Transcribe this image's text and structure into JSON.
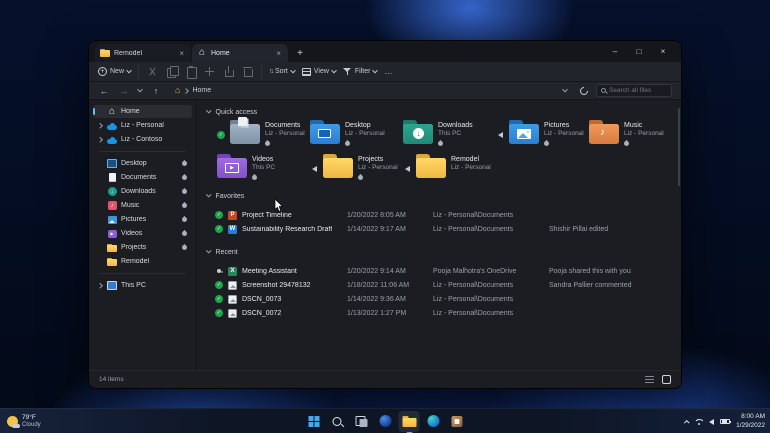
{
  "colors": {
    "accent": "#6cb8f0",
    "folder_yellow": "#f2b844",
    "status_green": "#1da54a"
  },
  "window": {
    "tabs": [
      {
        "label": "Remodel",
        "icon": "folder",
        "active": false,
        "close_icon": "×"
      },
      {
        "label": "Home",
        "icon": "home",
        "active": true,
        "close_icon": "×"
      }
    ],
    "new_tab_icon": "+",
    "controls": {
      "minimize": "–",
      "maximize": "□",
      "close": "×"
    },
    "toolbar": {
      "new_label": "New",
      "actions": [
        {
          "name": "cut-icon"
        },
        {
          "name": "copy-icon"
        },
        {
          "name": "paste-icon"
        },
        {
          "name": "rename-icon"
        },
        {
          "name": "share-icon"
        },
        {
          "name": "delete-icon"
        }
      ],
      "sort_label": "Sort",
      "view_label": "View",
      "filter_label": "Filter",
      "more_icon": "…"
    },
    "address": {
      "breadcrumb": "Home",
      "search_placeholder": "Search all files"
    },
    "sidebar": {
      "top_items": [
        {
          "label": "Home",
          "icon": "home",
          "selected": true
        },
        {
          "label": "Liz - Personal",
          "icon": "onedrive",
          "expandable": true
        },
        {
          "label": "Liz - Contoso",
          "icon": "onedrive",
          "expandable": true
        }
      ],
      "pinned_items": [
        {
          "label": "Desktop",
          "icon": "desktop",
          "pinned": true
        },
        {
          "label": "Documents",
          "icon": "documents",
          "pinned": true
        },
        {
          "label": "Downloads",
          "icon": "downloads",
          "pinned": true
        },
        {
          "label": "Music",
          "icon": "music",
          "pinned": true
        },
        {
          "label": "Pictures",
          "icon": "pictures",
          "pinned": true
        },
        {
          "label": "Videos",
          "icon": "videos",
          "pinned": true
        },
        {
          "label": "Projects",
          "icon": "folder",
          "pinned": true
        },
        {
          "label": "Remodel",
          "icon": "folder",
          "pinned": false
        }
      ],
      "bottom_items": [
        {
          "label": "This PC",
          "icon": "this-pc",
          "expandable": true
        }
      ]
    },
    "quick_access": {
      "label": "Quick access",
      "tiles": [
        {
          "name": "Documents",
          "location": "Liz - Personal",
          "icon": "documents-folder",
          "status": "available",
          "pinned": true
        },
        {
          "name": "Desktop",
          "location": "Liz - Personal",
          "icon": "desktop-folder",
          "pinned": true
        },
        {
          "name": "Downloads",
          "location": "This PC",
          "icon": "downloads-folder",
          "pinned": true
        },
        {
          "name": "Pictures",
          "location": "Liz - Personal",
          "icon": "pictures-folder",
          "status": "sync",
          "pinned": true
        },
        {
          "name": "Music",
          "location": "Liz - Personal",
          "icon": "music-folder",
          "pinned": true
        },
        {
          "name": "Videos",
          "location": "This PC",
          "icon": "videos-folder",
          "pinned": true
        },
        {
          "name": "Projects",
          "location": "Liz - Personal",
          "icon": "folder",
          "status": "sync",
          "pinned": true
        },
        {
          "name": "Remodel",
          "location": "Liz - Personal",
          "icon": "folder",
          "status": "sync",
          "pinned": false
        }
      ]
    },
    "favorites": {
      "label": "Favorites",
      "rows": [
        {
          "name": "Project Timeline",
          "icon": "powerpoint",
          "status": "available",
          "date": "1/20/2022 8:05 AM",
          "location": "Liz - Personal\\Documents",
          "activity": ""
        },
        {
          "name": "Sustainability Research Draft",
          "icon": "word",
          "status": "available",
          "date": "1/14/2022 9:17 AM",
          "location": "Liz - Personal\\Documents",
          "activity": "Shishir Pillai edited"
        }
      ]
    },
    "recent": {
      "label": "Recent",
      "rows": [
        {
          "name": "Meeting Assistant",
          "icon": "excel",
          "status": "shared",
          "date": "1/20/2022 9:14 AM",
          "location": "Pooja Malhotra's OneDrive",
          "activity": "Pooja shared this with you"
        },
        {
          "name": "Screenshot 29478132",
          "icon": "image",
          "status": "available",
          "date": "1/18/2022 11:06 AM",
          "location": "Liz - Personal\\Documents",
          "activity": "Sandra Pallier commented"
        },
        {
          "name": "DSCN_0073",
          "icon": "image",
          "status": "available",
          "date": "1/14/2022 9:36 AM",
          "location": "Liz - Personal\\Documents",
          "activity": ""
        },
        {
          "name": "DSCN_0072",
          "icon": "image",
          "status": "available",
          "date": "1/13/2022 1:27 PM",
          "location": "Liz - Personal\\Documents",
          "activity": ""
        }
      ]
    },
    "status_bar": {
      "items_count": "14 items"
    }
  },
  "taskbar": {
    "weather": {
      "temp": "79°F",
      "condition": "Cloudy"
    },
    "icons": [
      {
        "name": "start-icon",
        "active": false
      },
      {
        "name": "search-icon",
        "active": false
      },
      {
        "name": "task-view-icon",
        "active": false
      },
      {
        "name": "widgets-icon",
        "active": false
      },
      {
        "name": "file-explorer-icon",
        "active": true
      },
      {
        "name": "edge-icon",
        "active": false
      },
      {
        "name": "office-icon",
        "active": false
      }
    ],
    "tray": {
      "time": "8:00 AM",
      "date": "1/29/2022"
    }
  }
}
